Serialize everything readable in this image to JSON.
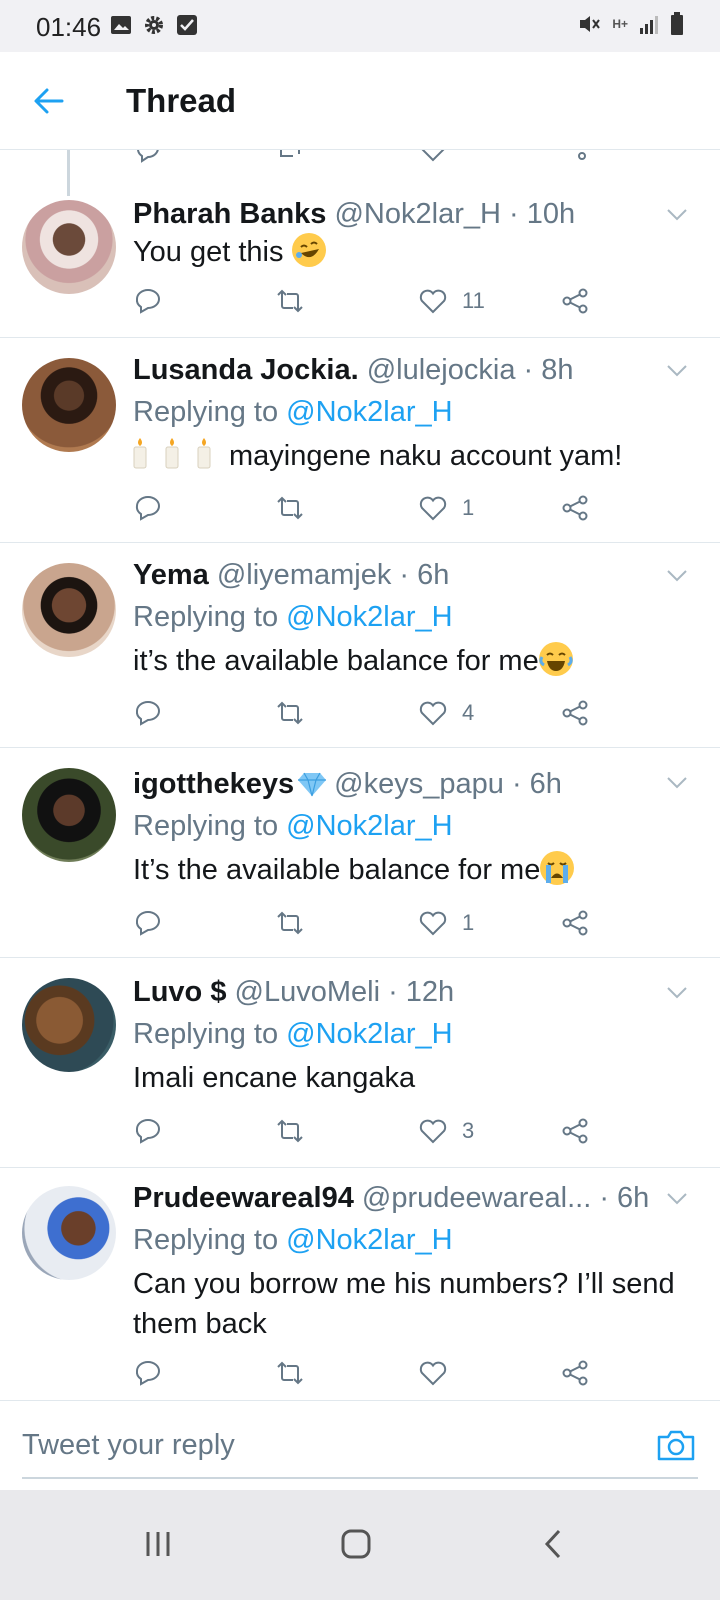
{
  "status_bar": {
    "time": "01:46",
    "left_icons": [
      "image-icon",
      "gear-icon",
      "checkbox-icon"
    ],
    "right_icons": [
      "mute-icon",
      "data-icon",
      "signal-icon",
      "battery-icon"
    ],
    "data_label": "H+"
  },
  "header": {
    "title": "Thread",
    "back_icon": "back-arrow-icon"
  },
  "colors": {
    "accent": "#1da1f2",
    "muted": "#657786",
    "text": "#14171a",
    "divider": "#e1e8ed"
  },
  "tweets": [
    {
      "name": "Pharah Banks",
      "meta": "@Nok2lar_H · 10h",
      "replying_prefix": "",
      "replying_handle": "",
      "text": "You get this",
      "emoji": "rofl",
      "likes": "11"
    },
    {
      "name": "Lusanda Jockia.",
      "meta": "@lulejockia · 8h",
      "replying_prefix": "Replying to ",
      "replying_handle": "@Nok2lar_H",
      "text": "mayingene naku account yam!",
      "emoji": "candles",
      "likes": "1"
    },
    {
      "name": "Yema",
      "meta": "@liyemamjek · 6h",
      "replying_prefix": "Replying to ",
      "replying_handle": "@Nok2lar_H",
      "text": "it’s the available balance for me",
      "emoji": "joy",
      "likes": "4"
    },
    {
      "name": "igotthekeys",
      "meta": "@keys_papu · 6h",
      "replying_prefix": "Replying to ",
      "replying_handle": "@Nok2lar_H",
      "text": "It’s the available balance for me",
      "emoji": "sob",
      "likes": "1"
    },
    {
      "name": "Luvo $",
      "meta": "@LuvoMeli · 12h",
      "replying_prefix": "Replying to ",
      "replying_handle": "@Nok2lar_H",
      "text": "Imali encane kangaka",
      "emoji": "",
      "likes": "3"
    },
    {
      "name": "Prudeewareal94",
      "meta": "@prudeewareal... · 6h",
      "replying_prefix": "Replying to ",
      "replying_handle": "@Nok2lar_H",
      "text": "Can you borrow me his numbers? I’ll send them back",
      "emoji": "",
      "likes": ""
    }
  ],
  "composer": {
    "placeholder": "Tweet your reply",
    "camera_icon": "camera-icon"
  },
  "nav_bar": {
    "icons": [
      "recents-icon",
      "home-icon",
      "back-icon"
    ]
  }
}
